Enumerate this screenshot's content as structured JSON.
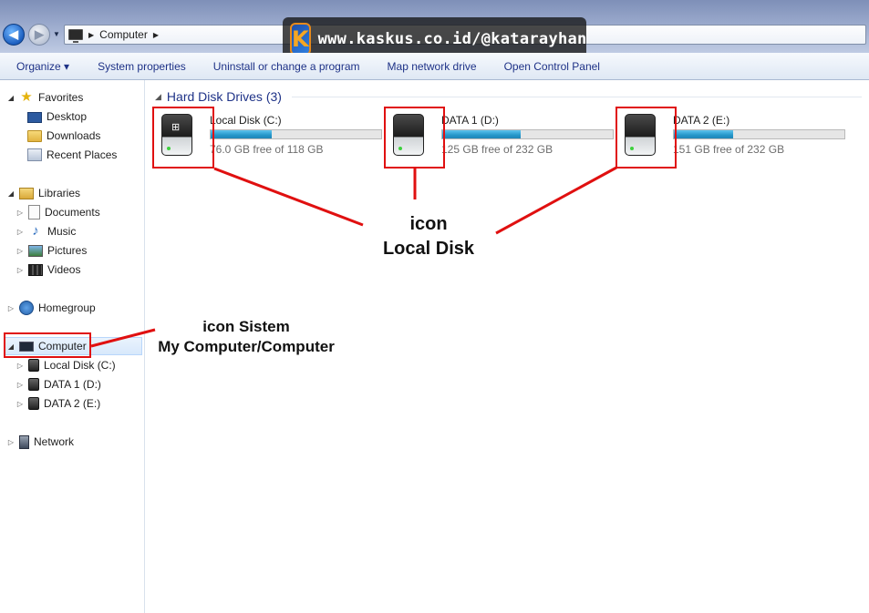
{
  "address": {
    "location": "Computer"
  },
  "watermark": {
    "logo": "K",
    "text": "www.kaskus.co.id/@katarayhan"
  },
  "toolbar": {
    "organize": "Organize ▾",
    "system_properties": "System properties",
    "uninstall": "Uninstall or change a program",
    "map_drive": "Map network drive",
    "control_panel": "Open Control Panel"
  },
  "sidebar": {
    "favorites": "Favorites",
    "desktop": "Desktop",
    "downloads": "Downloads",
    "recent": "Recent Places",
    "libraries": "Libraries",
    "documents": "Documents",
    "music": "Music",
    "pictures": "Pictures",
    "videos": "Videos",
    "homegroup": "Homegroup",
    "computer": "Computer",
    "local_c": "Local Disk (C:)",
    "data1": "DATA 1 (D:)",
    "data2": "DATA 2 (E:)",
    "network": "Network"
  },
  "content": {
    "group_label": "Hard Disk Drives (3)",
    "drives": [
      {
        "name": "Local Disk (C:)",
        "free": "76.0 GB free of 118 GB",
        "used_fraction": 0.36
      },
      {
        "name": "DATA 1 (D:)",
        "free": "125 GB free of 232 GB",
        "used_fraction": 0.46
      },
      {
        "name": "DATA 2 (E:)",
        "free": "151 GB free of 232 GB",
        "used_fraction": 0.35
      }
    ]
  },
  "annotations": {
    "disk_line1": "icon",
    "disk_line2": "Local Disk",
    "sys_line1": "icon Sistem",
    "sys_line2": "My Computer/Computer"
  },
  "colors": {
    "annotation": "#e01010",
    "link": "#1e3287",
    "bar": "#2596c9"
  }
}
